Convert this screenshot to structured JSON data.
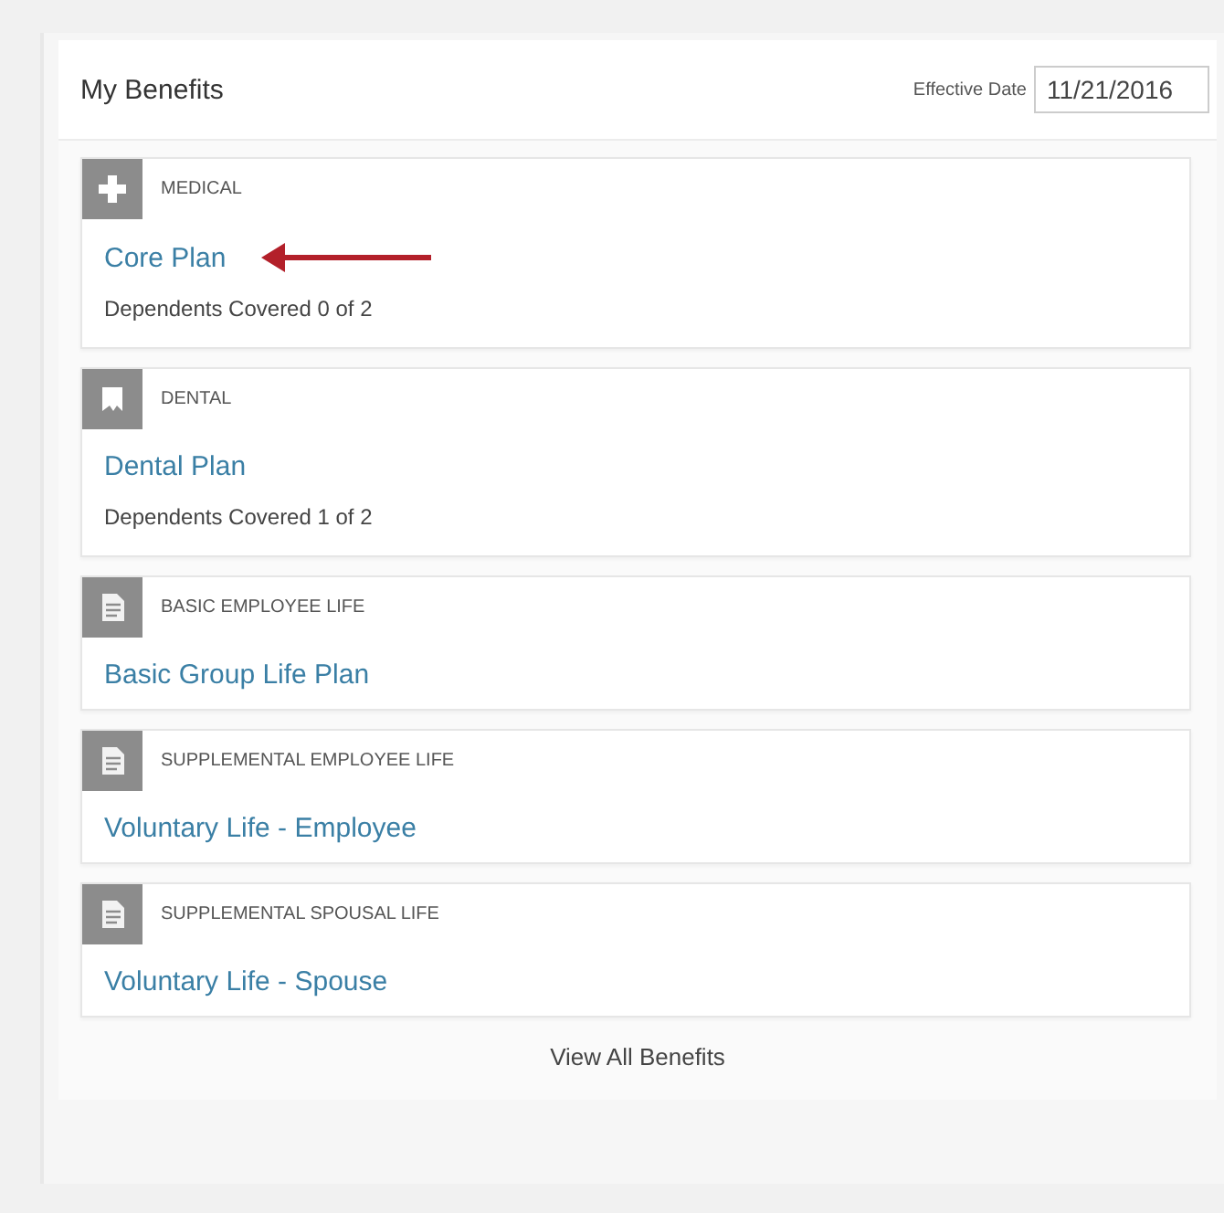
{
  "panel": {
    "title": "My Benefits",
    "effective_date": {
      "label": "Effective Date",
      "value": "11/21/2016"
    }
  },
  "benefits": [
    {
      "kind": "medical",
      "category": "MEDICAL",
      "plan": "Core Plan",
      "arrow": true,
      "dependents": "Dependents Covered 0 of 2"
    },
    {
      "kind": "dental",
      "category": "DENTAL",
      "plan": "Dental Plan",
      "arrow": false,
      "dependents": "Dependents Covered 1 of 2"
    },
    {
      "kind": "life",
      "category": "BASIC EMPLOYEE LIFE",
      "plan": "Basic Group Life Plan",
      "arrow": false
    },
    {
      "kind": "life",
      "category": "SUPPLEMENTAL EMPLOYEE LIFE",
      "plan": "Voluntary Life - Employee",
      "arrow": false
    },
    {
      "kind": "life",
      "category": "SUPPLEMENTAL SPOUSAL LIFE",
      "plan": "Voluntary Life - Spouse",
      "arrow": false
    }
  ],
  "footer_link": "View All Benefits"
}
